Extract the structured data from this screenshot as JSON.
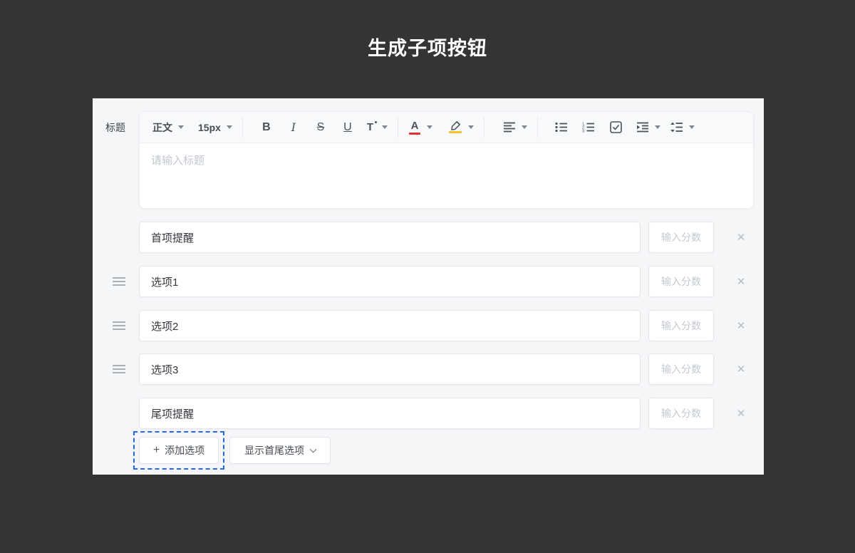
{
  "page": {
    "title": "生成子项按钮"
  },
  "colors": {
    "background": "#333435",
    "panel": "#f5f6f8",
    "accent_blue": "#2468f2",
    "font_color_indicator": "#e0312e",
    "highlight_indicator": "#f3c422"
  },
  "editor": {
    "field_label": "标题",
    "body_placeholder": "请输入标题",
    "toolbar": {
      "paragraph_label": "正文",
      "font_size_label": "15px",
      "bold_label": "B",
      "italic_label": "I",
      "strike_label": "S",
      "underline_label": "U",
      "transform_label": "T"
    }
  },
  "options": {
    "rows": [
      {
        "value": "首项提醒",
        "score_placeholder": "输入分数"
      },
      {
        "value": "选项1",
        "score_placeholder": "输入分数"
      },
      {
        "value": "选项2",
        "score_placeholder": "输入分数"
      },
      {
        "value": "选项3",
        "score_placeholder": "输入分数"
      },
      {
        "value": "尾项提醒",
        "score_placeholder": "输入分数"
      }
    ]
  },
  "icons": {
    "close": "✕"
  },
  "footer": {
    "add_option_icon": "+",
    "add_option_label": "添加选项",
    "show_range_label": "显示首尾选项"
  }
}
